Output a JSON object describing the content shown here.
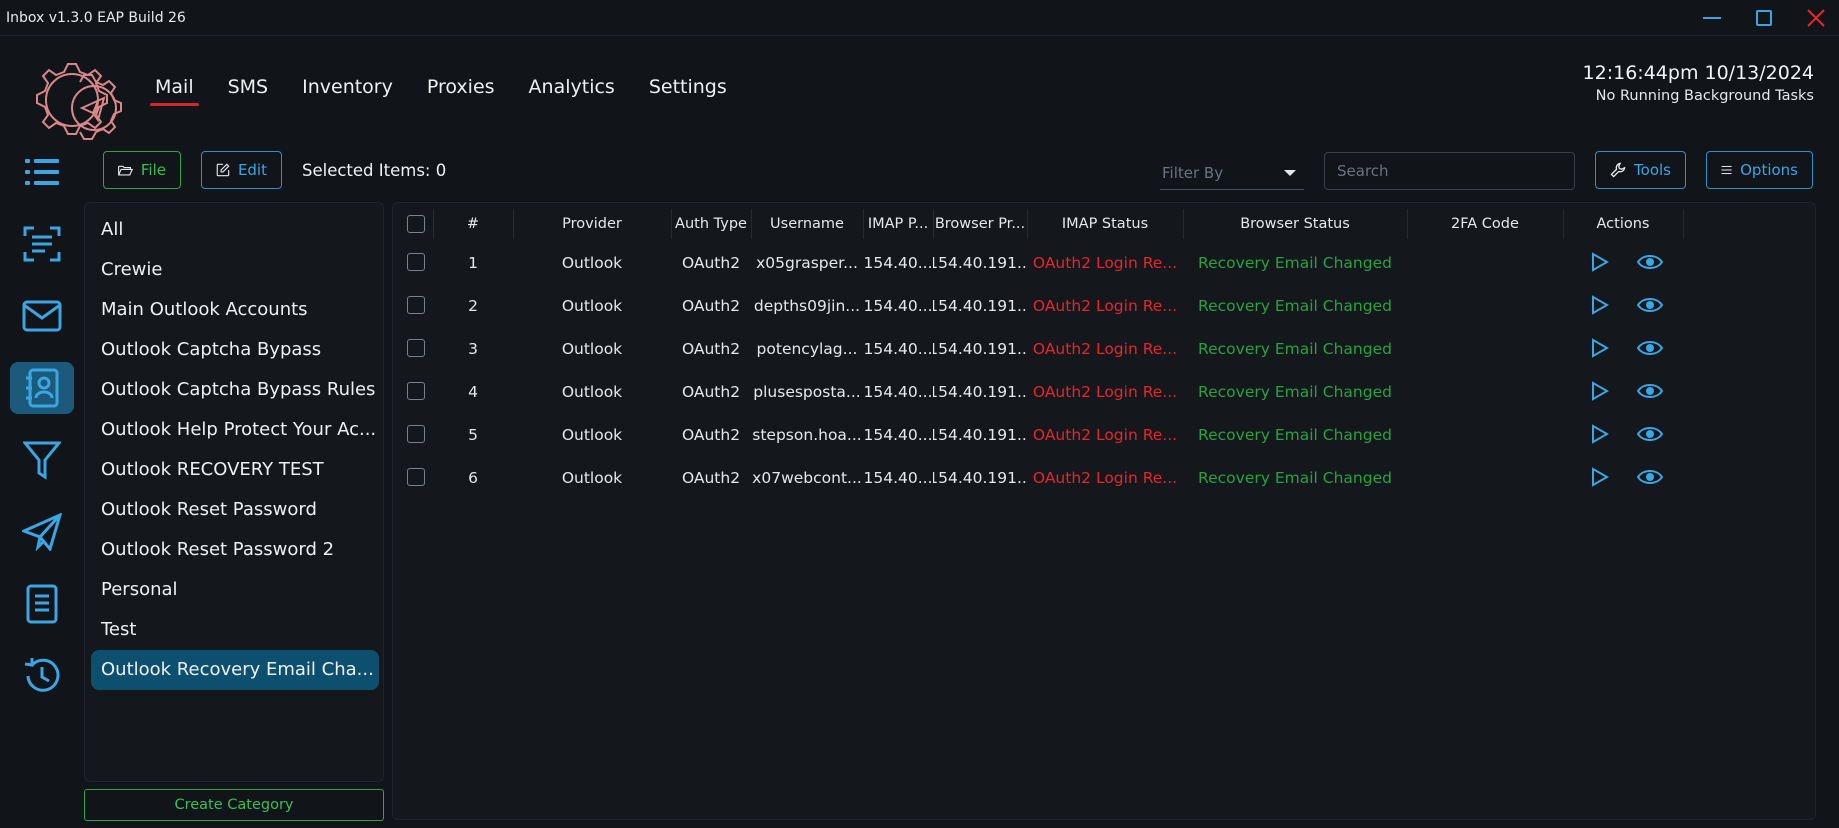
{
  "app": {
    "title": "Inbox v1.3.0 EAP Build 26"
  },
  "nav": {
    "items": [
      "Mail",
      "SMS",
      "Inventory",
      "Proxies",
      "Analytics",
      "Settings"
    ],
    "active": "Mail"
  },
  "clock": {
    "time": "12:16:44pm 10/13/2024",
    "tasks": "No Running Background Tasks"
  },
  "toolbar": {
    "file_label": "File",
    "edit_label": "Edit",
    "selected_items": "Selected Items: 0",
    "filter_placeholder": "Filter By",
    "search_placeholder": "Search",
    "tools_label": "Tools",
    "options_label": "Options"
  },
  "rail": {
    "icons": [
      "list-icon",
      "scan-icon",
      "mail-icon",
      "contacts-icon",
      "filter-icon",
      "send-icon",
      "book-icon",
      "history-icon"
    ],
    "active": "contacts-icon"
  },
  "categories": {
    "items": [
      "All",
      "Crewie",
      "Main Outlook Accounts",
      "Outlook Captcha Bypass",
      "Outlook Captcha Bypass Rules",
      "Outlook Help Protect Your Ac...",
      "Outlook RECOVERY TEST",
      "Outlook Reset Password",
      "Outlook Reset Password 2",
      "Personal",
      "Test",
      "Outlook Recovery Email Cha..."
    ],
    "active_index": 11,
    "create_label": "Create Category"
  },
  "table": {
    "columns": [
      "#",
      "Provider",
      "Auth Type",
      "Username",
      "IMAP P...",
      "Browser Pr...",
      "IMAP Status",
      "Browser Status",
      "2FA Code",
      "Actions"
    ],
    "rows": [
      {
        "num": "1",
        "provider": "Outlook",
        "auth": "OAuth2",
        "username": "x05grasper...",
        "imap_proxy": "154.40...",
        "browser_proxy": "154.40.191...",
        "imap_status": "OAuth2 Login Re...",
        "browser_status": "Recovery Email Changed",
        "twofa": ""
      },
      {
        "num": "2",
        "provider": "Outlook",
        "auth": "OAuth2",
        "username": "depths09jin...",
        "imap_proxy": "154.40...",
        "browser_proxy": "154.40.191...",
        "imap_status": "OAuth2 Login Re...",
        "browser_status": "Recovery Email Changed",
        "twofa": ""
      },
      {
        "num": "3",
        "provider": "Outlook",
        "auth": "OAuth2",
        "username": "potencylag...",
        "imap_proxy": "154.40...",
        "browser_proxy": "154.40.191...",
        "imap_status": "OAuth2 Login Re...",
        "browser_status": "Recovery Email Changed",
        "twofa": ""
      },
      {
        "num": "4",
        "provider": "Outlook",
        "auth": "OAuth2",
        "username": "plusesposta...",
        "imap_proxy": "154.40...",
        "browser_proxy": "154.40.191...",
        "imap_status": "OAuth2 Login Re...",
        "browser_status": "Recovery Email Changed",
        "twofa": ""
      },
      {
        "num": "5",
        "provider": "Outlook",
        "auth": "OAuth2",
        "username": "stepson.hoa...",
        "imap_proxy": "154.40...",
        "browser_proxy": "154.40.191...",
        "imap_status": "OAuth2 Login Re...",
        "browser_status": "Recovery Email Changed",
        "twofa": ""
      },
      {
        "num": "6",
        "provider": "Outlook",
        "auth": "OAuth2",
        "username": "x07webcont...",
        "imap_proxy": "154.40...",
        "browser_proxy": "154.40.191...",
        "imap_status": "OAuth2 Login Re...",
        "browser_status": "Recovery Email Changed",
        "twofa": ""
      }
    ]
  },
  "colors": {
    "accent_blue": "#3aa6e4",
    "accent_green": "#3cbf57",
    "status_red": "#e5262b",
    "status_green": "#27a33f",
    "nav_underline": "#d7262b",
    "logo": "#d9888a"
  }
}
